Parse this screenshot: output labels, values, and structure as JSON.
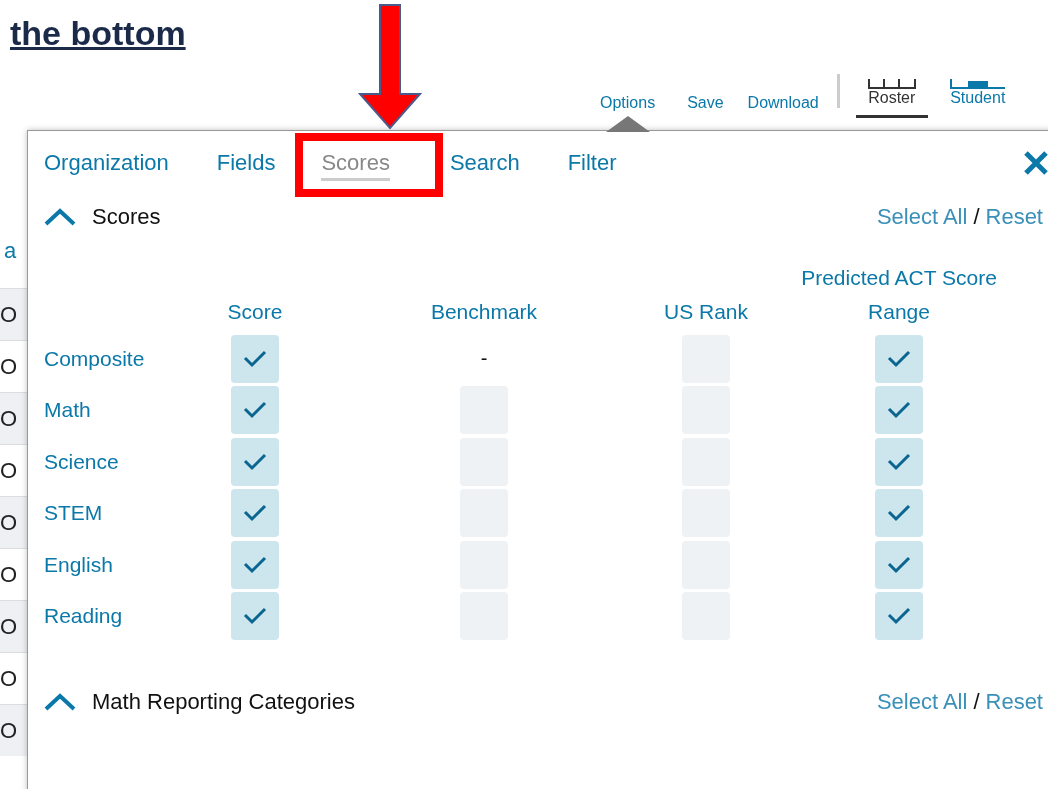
{
  "heading": "the bottom",
  "background_table": {
    "header": "a",
    "rows": [
      "O",
      "O",
      "O",
      "O",
      "O",
      "O",
      "O",
      "O",
      "O"
    ]
  },
  "toolbar": {
    "actions": [
      {
        "label": "Options",
        "selected": true
      },
      {
        "label": "Save",
        "selected": false
      },
      {
        "label": "Download",
        "selected": false
      }
    ],
    "views": [
      {
        "label": "Roster",
        "selected": true
      },
      {
        "label": "Student",
        "selected": false
      }
    ]
  },
  "panel": {
    "tabs": [
      {
        "label": "Organization",
        "selected": false
      },
      {
        "label": "Fields",
        "selected": false
      },
      {
        "label": "Scores",
        "selected": true
      },
      {
        "label": "Search",
        "selected": false
      },
      {
        "label": "Filter",
        "selected": false
      }
    ],
    "sections": [
      {
        "title": "Scores",
        "expanded": true,
        "select_all": "Select All",
        "separator": "/",
        "reset": "Reset",
        "columns": [
          "Score",
          "Benchmark",
          "US Rank",
          "Predicted ACT Score Range"
        ],
        "rows": [
          {
            "label": "Composite",
            "cells": [
              {
                "kind": "checkbox",
                "checked": true
              },
              {
                "kind": "text",
                "text": "-"
              },
              {
                "kind": "checkbox",
                "checked": false
              },
              {
                "kind": "checkbox",
                "checked": true
              }
            ]
          },
          {
            "label": "Math",
            "cells": [
              {
                "kind": "checkbox",
                "checked": true
              },
              {
                "kind": "checkbox",
                "checked": false
              },
              {
                "kind": "checkbox",
                "checked": false
              },
              {
                "kind": "checkbox",
                "checked": true
              }
            ]
          },
          {
            "label": "Science",
            "cells": [
              {
                "kind": "checkbox",
                "checked": true
              },
              {
                "kind": "checkbox",
                "checked": false
              },
              {
                "kind": "checkbox",
                "checked": false
              },
              {
                "kind": "checkbox",
                "checked": true
              }
            ]
          },
          {
            "label": "STEM",
            "cells": [
              {
                "kind": "checkbox",
                "checked": true
              },
              {
                "kind": "checkbox",
                "checked": false
              },
              {
                "kind": "checkbox",
                "checked": false
              },
              {
                "kind": "checkbox",
                "checked": true
              }
            ]
          },
          {
            "label": "English",
            "cells": [
              {
                "kind": "checkbox",
                "checked": true
              },
              {
                "kind": "checkbox",
                "checked": false
              },
              {
                "kind": "checkbox",
                "checked": false
              },
              {
                "kind": "checkbox",
                "checked": true
              }
            ]
          },
          {
            "label": "Reading",
            "cells": [
              {
                "kind": "checkbox",
                "checked": true
              },
              {
                "kind": "checkbox",
                "checked": false
              },
              {
                "kind": "checkbox",
                "checked": false
              },
              {
                "kind": "checkbox",
                "checked": true
              }
            ]
          }
        ]
      },
      {
        "title": "Math Reporting Categories",
        "expanded": true,
        "select_all": "Select All",
        "separator": "/",
        "reset": "Reset"
      }
    ]
  }
}
